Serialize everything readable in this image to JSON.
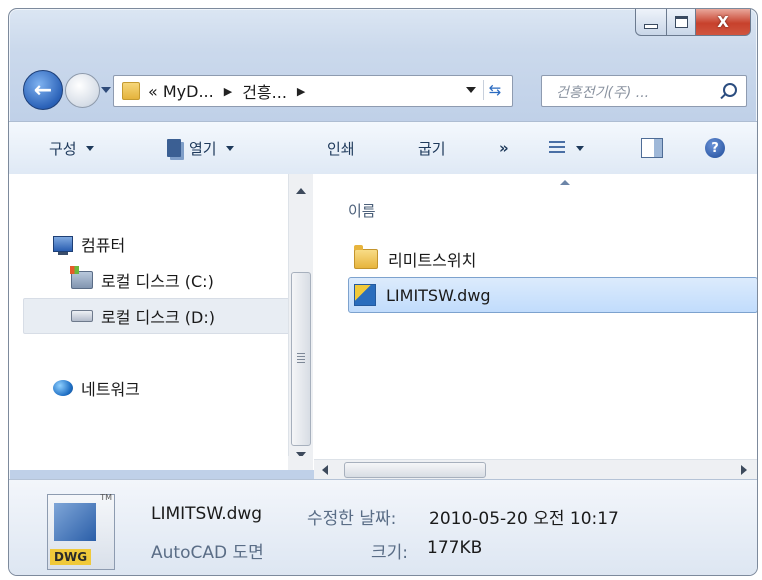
{
  "window": {
    "close_glyph": "X"
  },
  "navigation": {
    "breadcrumb": [
      "« MyD...",
      "건흥..."
    ],
    "search_placeholder": "건흥전기(주) ..."
  },
  "toolbar": {
    "organize": "구성",
    "open": "열기",
    "print": "인쇄",
    "burn": "굽기",
    "more": "»"
  },
  "nav_pane": {
    "items": [
      {
        "label": "컴퓨터",
        "icon": "computer-icon"
      },
      {
        "label": "로컬 디스크 (C:)",
        "icon": "system-drive-icon"
      },
      {
        "label": "로컬 디스크 (D:)",
        "icon": "drive-icon",
        "selected": true
      },
      {
        "label": "네트워크",
        "icon": "network-icon"
      }
    ]
  },
  "file_list": {
    "column_name": "이름",
    "items": [
      {
        "name": "리미트스위치",
        "type": "folder"
      },
      {
        "name": "LIMITSW.dwg",
        "type": "dwg",
        "selected": true
      }
    ]
  },
  "details": {
    "file_name": "LIMITSW.dwg",
    "file_type": "AutoCAD 도면",
    "date_label": "수정한 날짜:",
    "date_value": "2010-05-20 오전 10:17",
    "size_label": "크기:",
    "size_value": "177KB",
    "thumb_label": "DWG",
    "thumb_mark": "TM"
  },
  "colors": {
    "selection": "#c1dcfc",
    "window_frame": "#bfd0e8",
    "close_button": "#c7412c"
  }
}
